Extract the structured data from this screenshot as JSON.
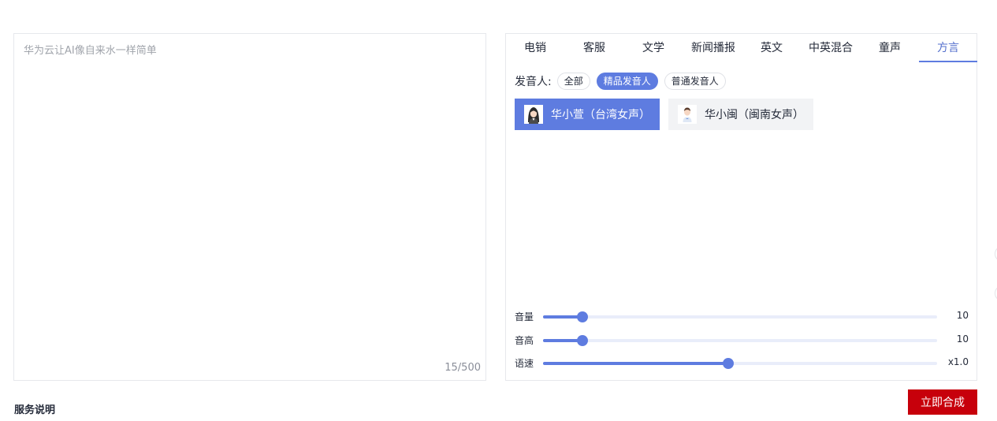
{
  "editor": {
    "placeholder": "华为云让AI像自来水一样简单",
    "counter": "15/500"
  },
  "tabs": [
    {
      "label": "电销"
    },
    {
      "label": "客服"
    },
    {
      "label": "文学"
    },
    {
      "label": "新闻播报"
    },
    {
      "label": "英文"
    },
    {
      "label": "中英混合"
    },
    {
      "label": "童声"
    },
    {
      "label": "方言",
      "active": true
    }
  ],
  "speaker_filter": {
    "label": "发音人:",
    "options": [
      {
        "label": "全部"
      },
      {
        "label": "精品发音人",
        "active": true
      },
      {
        "label": "普通发音人"
      }
    ]
  },
  "voices": [
    {
      "name": "华小萱（台湾女声）",
      "selected": true,
      "icon": "female-avatar-icon"
    },
    {
      "name": "华小闽（闽南女声）",
      "selected": false,
      "icon": "avatar-icon"
    }
  ],
  "sliders": [
    {
      "label": "音量",
      "value": "10",
      "fraction": 0.1
    },
    {
      "label": "音高",
      "value": "10",
      "fraction": 0.1
    },
    {
      "label": "语速",
      "value": "x1.0",
      "fraction": 0.47
    }
  ],
  "footer": {
    "service_title": "服务说明",
    "submit_label": "立即合成"
  },
  "colors": {
    "accent": "#5e7ce0",
    "primary_button": "#c7000b"
  }
}
